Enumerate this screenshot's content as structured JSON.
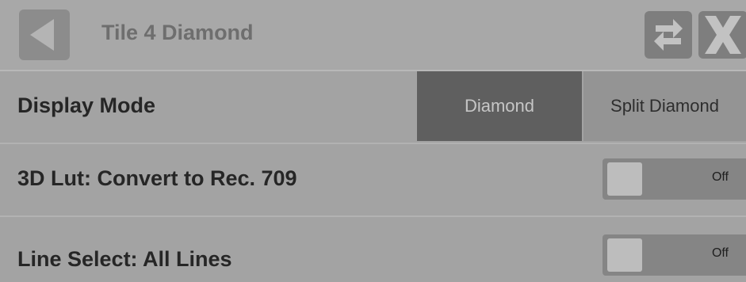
{
  "header": {
    "title": "Tile 4 Diamond",
    "back_icon": "back-arrow-icon",
    "swap_icon": "swap-arrows-icon",
    "close_icon": "close-x-icon"
  },
  "rows": [
    {
      "label": "Display Mode",
      "options": [
        "Diamond",
        "Split Diamond"
      ],
      "selected": "Diamond"
    },
    {
      "label": "3D Lut: Convert to Rec. 709",
      "toggle_text": "Off"
    },
    {
      "label": "Line Select: All Lines",
      "toggle_text": "Off"
    }
  ],
  "colors": {
    "background": "#a3a3a3",
    "selected_segment": "#5f5f5f",
    "toggle_track": "#858585"
  }
}
